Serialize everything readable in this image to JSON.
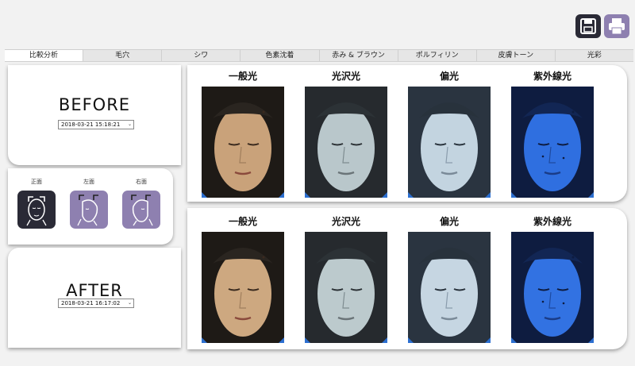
{
  "toolbar": {
    "save_icon": "floppy-disk-icon",
    "print_icon": "printer-icon"
  },
  "tabs": [
    {
      "label": "比較分析",
      "active": true
    },
    {
      "label": "毛穴",
      "active": false
    },
    {
      "label": "シワ",
      "active": false
    },
    {
      "label": "色素沈着",
      "active": false
    },
    {
      "label": "赤み & ブラウン",
      "active": false
    },
    {
      "label": "ポルフィリン",
      "active": false
    },
    {
      "label": "皮膚トーン",
      "active": false
    },
    {
      "label": "光彩",
      "active": false
    }
  ],
  "before": {
    "title": "BEFORE",
    "date": "2018-03-21 15:18:21"
  },
  "after": {
    "title": "AFTER",
    "date": "2018-03-21 16:17:02"
  },
  "views": [
    {
      "label": "正面",
      "icon": "face-front-icon"
    },
    {
      "label": "左面",
      "icon": "face-left-icon"
    },
    {
      "label": "右面",
      "icon": "face-right-icon"
    }
  ],
  "light_modes": [
    "一般光",
    "光沢光",
    "偏光",
    "紫外線光"
  ],
  "colors": {
    "accent_purple": "#8e80b0",
    "dark_icon": "#2a2a36",
    "uv_blue": "#2f6fe0"
  }
}
